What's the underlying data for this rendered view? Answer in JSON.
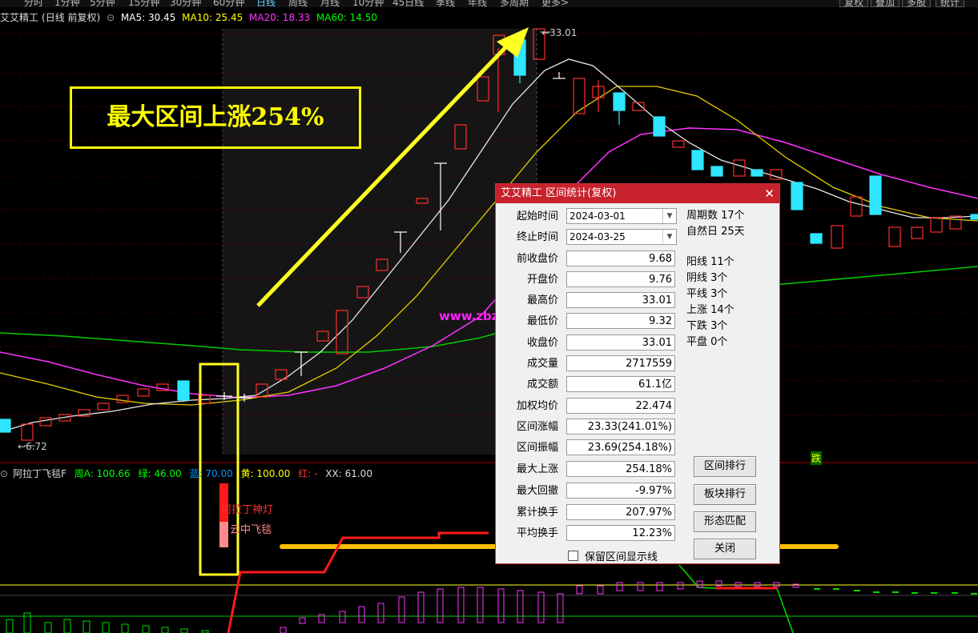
{
  "toolbar": {
    "tabs": [
      "分时",
      "1分钟",
      "5分钟",
      "15分钟",
      "30分钟",
      "60分钟",
      "日线",
      "周线",
      "月线",
      "10分钟",
      "45日线",
      "季线",
      "年线",
      "多周期",
      "更多>"
    ],
    "buttons": [
      "复权",
      "叠加",
      "多股",
      "统计"
    ]
  },
  "chart_header": {
    "stock": "艾艾精工",
    "mode": "(日线 前复权)",
    "ma5": "MA5: 30.45",
    "ma10": "MA10: 25.45",
    "ma20": "MA20: 18.33",
    "ma60": "MA60: 14.50",
    "colors": {
      "ma5": "#ffffff",
      "ma10": "#ffff00",
      "ma20": "#ff33ff",
      "ma60": "#00ff00"
    }
  },
  "annotations": {
    "banner": "最大区间上涨254%",
    "high_label": "33.01",
    "low_label": "6.72",
    "watermark": "www.zbzfwu.com",
    "die_tag": "跌"
  },
  "indicator": {
    "name": "阿拉丁飞毯F",
    "zhouA": "周A: 100.66",
    "lv": "绿: 46.00",
    "lan": "蓝: 70.00",
    "huang": "黄: 100.00",
    "hong": "红: -",
    "xx": "XX: 61.00",
    "legend1": "阿拉丁神灯",
    "legend2": "云中飞毯"
  },
  "dialog": {
    "title": "艾艾精工 区间统计(复权)",
    "start_label": "起始时间",
    "start_value": "2024-03-01",
    "end_label": "终止时间",
    "end_value": "2024-03-25",
    "rows": [
      {
        "label": "前收盘价",
        "value": "9.68"
      },
      {
        "label": "开盘价",
        "value": "9.76"
      },
      {
        "label": "最高价",
        "value": "33.01"
      },
      {
        "label": "最低价",
        "value": "9.32"
      },
      {
        "label": "收盘价",
        "value": "33.01"
      },
      {
        "label": "成交量",
        "value": "2717559"
      },
      {
        "label": "成交额",
        "value": "61.1亿"
      },
      {
        "label": "加权均价",
        "value": "22.474"
      },
      {
        "label": "区间涨幅",
        "value": "23.33(241.01%)"
      },
      {
        "label": "区间振幅",
        "value": "23.69(254.18%)"
      },
      {
        "label": "最大上涨",
        "value": "254.18%"
      },
      {
        "label": "最大回撤",
        "value": "-9.97%"
      },
      {
        "label": "累计换手",
        "value": "207.97%"
      },
      {
        "label": "平均换手",
        "value": "12.23%"
      }
    ],
    "stats_top": [
      "周期数 17个",
      "自然日 25天"
    ],
    "stats_bottom": [
      "阳线 11个",
      "阴线 3个",
      "平线 3个",
      "上涨 14个",
      "下跌 3个",
      "平盘 0个"
    ],
    "buttons": [
      "区间排行",
      "板块排行",
      "形态匹配",
      "关闭"
    ],
    "checkbox_label": "保留区间显示线"
  }
}
